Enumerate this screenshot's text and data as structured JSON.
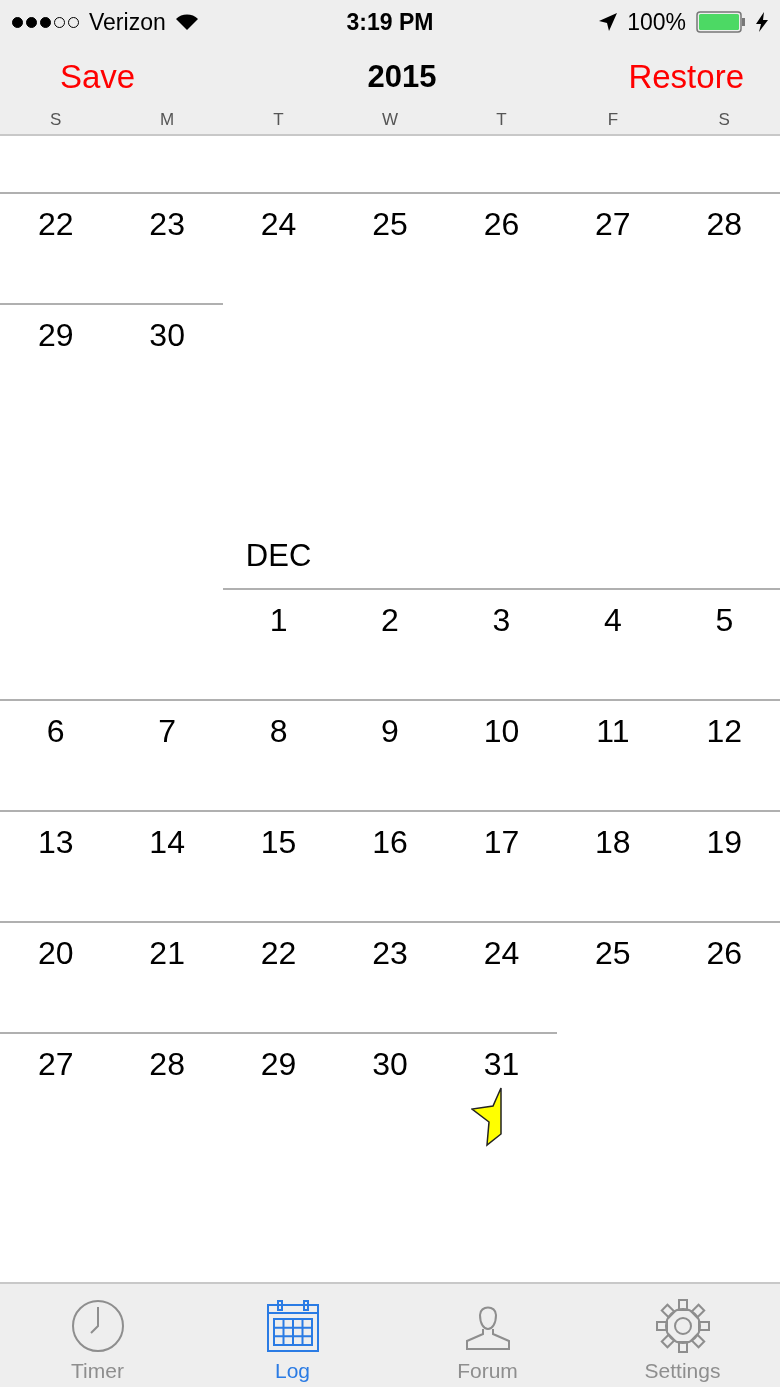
{
  "status_bar": {
    "carrier": "Verizon",
    "time": "3:19 PM",
    "battery": "100%"
  },
  "nav": {
    "left": "Save",
    "title": "2015",
    "right": "Restore"
  },
  "weekdays": [
    "S",
    "M",
    "T",
    "W",
    "T",
    "F",
    "S"
  ],
  "months": [
    {
      "weeks": [
        {
          "kind": "full",
          "days": [
            {
              "day": "22",
              "starred": false
            },
            {
              "day": "23",
              "starred": false
            },
            {
              "day": "24",
              "starred": false
            },
            {
              "day": "25",
              "starred": false
            },
            {
              "day": "26",
              "starred": false
            },
            {
              "day": "27",
              "starred": false
            },
            {
              "day": "28",
              "starred": false
            }
          ]
        },
        {
          "kind": "ends_early",
          "days": [
            {
              "day": "29",
              "starred": false
            },
            {
              "day": "30",
              "starred": false
            }
          ]
        }
      ]
    },
    {
      "label": "DEC",
      "weeks": [
        {
          "kind": "starts_late",
          "days": [
            {
              "day": "1",
              "starred": false
            },
            {
              "day": "2",
              "starred": false
            },
            {
              "day": "3",
              "starred": false
            },
            {
              "day": "4",
              "starred": false
            },
            {
              "day": "5",
              "starred": false
            }
          ]
        },
        {
          "kind": "full",
          "days": [
            {
              "day": "6",
              "starred": false
            },
            {
              "day": "7",
              "starred": false
            },
            {
              "day": "8",
              "starred": false
            },
            {
              "day": "9",
              "starred": false
            },
            {
              "day": "10",
              "starred": false
            },
            {
              "day": "11",
              "starred": false
            },
            {
              "day": "12",
              "starred": false
            }
          ]
        },
        {
          "kind": "full",
          "days": [
            {
              "day": "13",
              "starred": false
            },
            {
              "day": "14",
              "starred": false
            },
            {
              "day": "15",
              "starred": false
            },
            {
              "day": "16",
              "starred": false
            },
            {
              "day": "17",
              "starred": false
            },
            {
              "day": "18",
              "starred": false
            },
            {
              "day": "19",
              "starred": false
            }
          ]
        },
        {
          "kind": "full",
          "days": [
            {
              "day": "20",
              "starred": false
            },
            {
              "day": "21",
              "starred": false
            },
            {
              "day": "22",
              "starred": false
            },
            {
              "day": "23",
              "starred": false
            },
            {
              "day": "24",
              "starred": false
            },
            {
              "day": "25",
              "starred": false
            },
            {
              "day": "26",
              "starred": false
            }
          ]
        },
        {
          "kind": "ends_early",
          "days": [
            {
              "day": "27",
              "starred": false
            },
            {
              "day": "28",
              "starred": false
            },
            {
              "day": "29",
              "starred": false
            },
            {
              "day": "30",
              "starred": false
            },
            {
              "day": "31",
              "starred": true
            }
          ]
        }
      ]
    }
  ],
  "tabs": [
    {
      "kind": "clock",
      "label": "Timer",
      "selected": false
    },
    {
      "kind": "calendar",
      "label": "Log",
      "selected": true
    },
    {
      "kind": "person",
      "label": "Forum",
      "selected": false
    },
    {
      "kind": "gear",
      "label": "Settings",
      "selected": false
    }
  ]
}
